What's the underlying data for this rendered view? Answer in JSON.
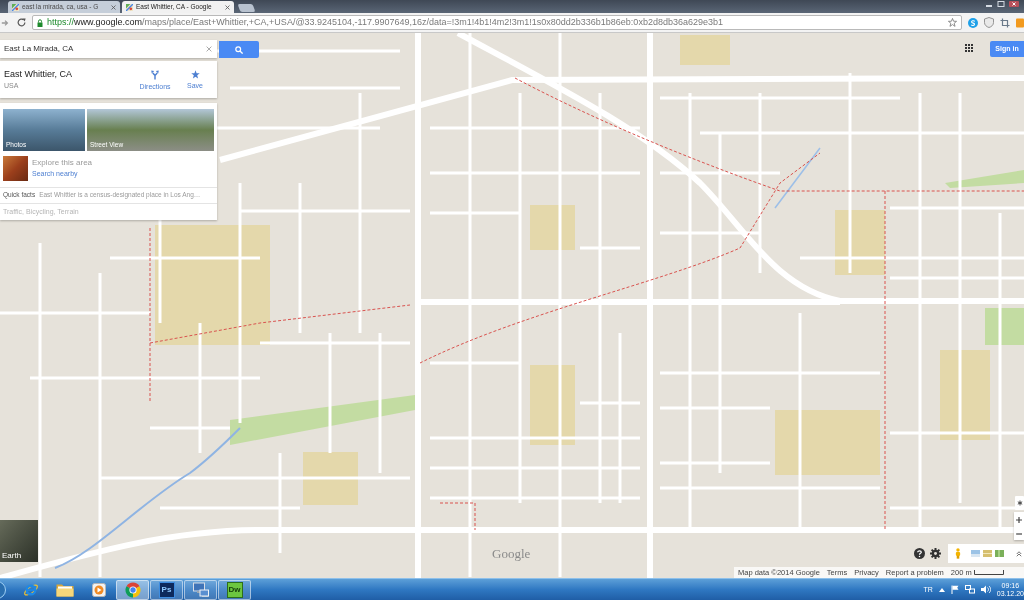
{
  "browser": {
    "tabs": [
      {
        "title": "east la mirada, ca, usa - G",
        "selected": false
      },
      {
        "title": "East Whittier, CA - Google",
        "selected": true
      }
    ],
    "url": {
      "scheme": "https://",
      "host": "www.google.com",
      "path": "/maps/place/East+Whittier,+CA,+USA/@33.9245104,-117.9907649,16z/data=!3m1!4b1!4m2!3m1!1s0x80dd2b336b1b86eb:0xb2d8db36a629e3b1"
    }
  },
  "search": {
    "value": "East La Mirada, CA"
  },
  "place": {
    "title": "East Whittier, CA",
    "subtitle": "USA",
    "actions": [
      {
        "kind": "directions",
        "label": "Directions"
      },
      {
        "kind": "save",
        "label": "Save"
      }
    ]
  },
  "media": [
    {
      "kind": "photos",
      "label": "Photos"
    },
    {
      "kind": "street_view",
      "label": "Street View"
    }
  ],
  "explore": {
    "title": "Explore this area",
    "link": "Search nearby"
  },
  "quick_facts": {
    "label": "Quick facts",
    "text": "East Whittier is a census-designated place in Los Ang…"
  },
  "layers": "Traffic, Bicycling, Terrain",
  "account": {
    "sign_in": "Sign in"
  },
  "earth": {
    "label": "Earth"
  },
  "logo": "Google",
  "footer": {
    "attribution": "Map data ©2014 Google",
    "links": [
      "Terms",
      "Privacy",
      "Report a problem"
    ],
    "scale": "200 m"
  },
  "taskbar": {
    "apps": [
      {
        "kind": "ie",
        "running": false,
        "selected": false
      },
      {
        "kind": "explorer",
        "running": false,
        "selected": false
      },
      {
        "kind": "media",
        "running": false,
        "selected": false
      },
      {
        "kind": "chrome",
        "running": true,
        "selected": true
      },
      {
        "kind": "photoshop",
        "label": "Ps",
        "running": true,
        "selected": false
      },
      {
        "kind": "remote",
        "running": true,
        "selected": false
      },
      {
        "kind": "dreamweaver",
        "label": "Dw",
        "running": true,
        "selected": false
      }
    ],
    "language": "TR",
    "time": "09:16",
    "date": "03.12.20"
  }
}
